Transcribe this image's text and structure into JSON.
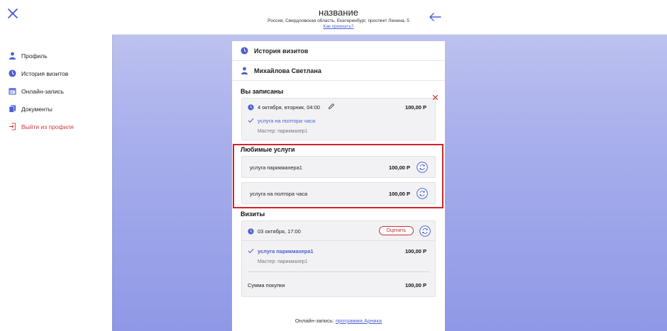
{
  "sidebar": {
    "items": [
      {
        "label": "Профиль",
        "icon": "person-icon"
      },
      {
        "label": "История визитов",
        "icon": "clock-icon"
      },
      {
        "label": "Онлайн-запись",
        "icon": "calendar-icon"
      },
      {
        "label": "Документы",
        "icon": "documents-icon"
      },
      {
        "label": "Выйти из профиля",
        "icon": "logout-icon"
      }
    ]
  },
  "header": {
    "title": "название",
    "address": "Россия, Свердловская область, Екатеринбург, проспект Ленина, 5",
    "directions_link": "Как проехать?"
  },
  "panel": {
    "history_title": "История визитов",
    "user_name": "Михайлова Светлана",
    "booked": {
      "title": "Вы записаны",
      "datetime": "4 октября, вторник, 04:00",
      "price": "100,00 Р",
      "service": "услуга на полтора часа",
      "master": "Мастер: парикмахер1"
    },
    "favorites": {
      "title": "Любимые услуги",
      "items": [
        {
          "name": "услуга парикмахера1",
          "price": "100,00 Р"
        },
        {
          "name": "услуга на полтора часа",
          "price": "100,00 Р"
        }
      ]
    },
    "visits": {
      "title": "Визиты",
      "datetime": "03 октября, 17:00",
      "rate_label": "Оценить",
      "service": "услуга парикмахера1",
      "service_price": "100,00 Р",
      "master": "Мастер: парикмахер1",
      "total_label": "Сумма покупки",
      "total_price": "100,00 Р"
    },
    "footer": {
      "prefix": "Онлайн-запись:",
      "link": "программа Арника"
    }
  },
  "colors": {
    "accent": "#4a5fd0",
    "danger": "#d33a3a",
    "highlight": "#d3222a"
  }
}
